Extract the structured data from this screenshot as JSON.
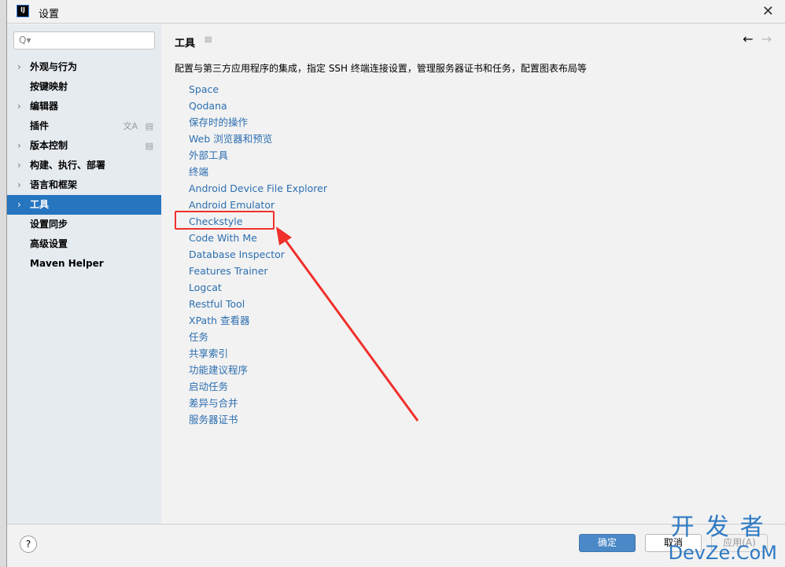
{
  "window": {
    "title": "设置",
    "logo": "IJ"
  },
  "search": {
    "placeholder": "Q▾"
  },
  "sidebar": {
    "items": [
      {
        "label": "外观与行为",
        "chevron": true
      },
      {
        "label": "按键映射",
        "chevron": false
      },
      {
        "label": "编辑器",
        "chevron": true
      },
      {
        "label": "插件",
        "chevron": false,
        "icons": [
          "translate-icon",
          "settings-icon"
        ]
      },
      {
        "label": "版本控制",
        "chevron": true,
        "icons": [
          "settings-icon"
        ]
      },
      {
        "label": "构建、执行、部署",
        "chevron": true
      },
      {
        "label": "语言和框架",
        "chevron": true
      },
      {
        "label": "工具",
        "chevron": true,
        "selected": true
      },
      {
        "label": "设置同步",
        "chevron": false
      },
      {
        "label": "高级设置",
        "chevron": false
      },
      {
        "label": "Maven Helper",
        "chevron": false
      }
    ]
  },
  "main": {
    "title": "工具",
    "description": "配置与第三方应用程序的集成，指定 SSH 终端连接设置，管理服务器证书和任务，配置图表布局等",
    "links": [
      "Space",
      "Qodana",
      "保存时的操作",
      "Web 浏览器和预览",
      "外部工具",
      "终端",
      "Android Device File Explorer",
      "Android Emulator",
      "Checkstyle",
      "Code With Me",
      "Database Inspector",
      "Features Trainer",
      "Logcat",
      "Restful Tool",
      "XPath 查看器",
      "任务",
      "共享索引",
      "功能建议程序",
      "启动任务",
      "差异与合并",
      "服务器证书"
    ],
    "highlighted": "Checkstyle"
  },
  "footer": {
    "help": "?",
    "ok": "确定",
    "cancel": "取消",
    "apply": "应用(A)"
  },
  "watermark": {
    "line1": "开发者",
    "line2": "DevZe.CoM"
  },
  "colors": {
    "accent": "#2675bf",
    "link": "#2d6fb0",
    "highlight": "#f0302c"
  }
}
